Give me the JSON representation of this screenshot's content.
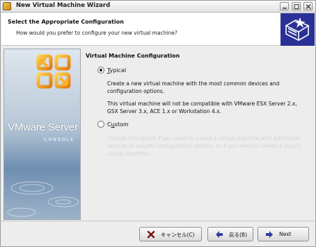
{
  "window": {
    "title": "New Virtual Machine Wizard"
  },
  "header": {
    "title": "Select the Appropriate Configuration",
    "subtitle": "How would you prefer to configure your new virtual machine?"
  },
  "side_panel": {
    "brand": "VMware Server",
    "subbrand": "CONSOLE"
  },
  "main": {
    "section_title": "Virtual Machine Configuration",
    "options": [
      {
        "label_prefix": "",
        "label_mnemonic": "T",
        "label_suffix": "ypical",
        "selected": true,
        "description": "Create a new virtual machine with the most common devices and configuration options.",
        "note": "This virtual machine will not be compatible with VMware ESX Server 2.x, GSX Server 3.x, ACE 1.x or Workstation 4.x."
      },
      {
        "label_prefix": "C",
        "label_mnemonic": "u",
        "label_suffix": "stom",
        "selected": false,
        "description": "Choose this option if you need to create a virtual machine with additional devices or specific configuration options, or if you need to create a legacy virtual machine."
      }
    ]
  },
  "buttons": {
    "cancel": "キャンセル(C)",
    "back": "戻る(B)",
    "next": "Next"
  },
  "colors": {
    "header_icon_bg": "#2a3196",
    "cancel_icon": "#7a0d0d",
    "nav_arrow": "#2f3f9e"
  }
}
